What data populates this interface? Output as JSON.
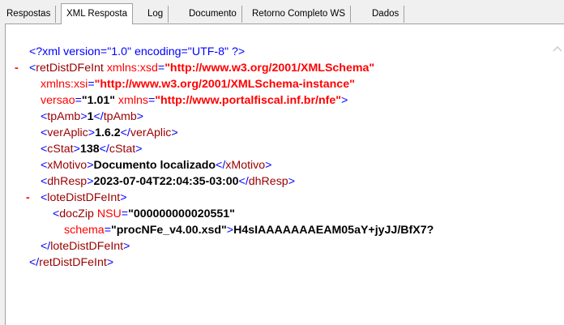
{
  "tabs": [
    {
      "label": "Respostas",
      "active": false
    },
    {
      "label": "XML Resposta",
      "active": true
    },
    {
      "label": "Log",
      "active": false
    },
    {
      "label": "Documento",
      "active": false
    },
    {
      "label": "Retorno Completo WS",
      "active": false
    },
    {
      "label": "Dados",
      "active": false
    }
  ],
  "xml": {
    "decl_open": "<?xml version=\"1.0\" encoding=\"UTF-8\" ?>",
    "toggle": "-",
    "root_open": "<",
    "root_name": "retDistDFeInt",
    "attr_xsd_name": " xmlns:xsd",
    "eq": "=",
    "attr_xsd_val": "\"http://www.w3.org/2001/XMLSchema\"",
    "attr_xsi_name": "xmlns:xsi",
    "attr_xsi_val": "\"http://www.w3.org/2001/XMLSchema-instance\"",
    "attr_versao_name": "versao",
    "attr_versao_val": "\"1.01\"",
    "attr_xmlns_name": " xmlns",
    "attr_xmlns_val": "\"http://www.portalfiscal.inf.br/nfe\"",
    "gt": ">",
    "lt": "<",
    "close_lt": "</",
    "tpAmb_name": "tpAmb",
    "tpAmb_val": "1",
    "verAplic_name": "verAplic",
    "verAplic_val": "1.6.2",
    "cStat_name": "cStat",
    "cStat_val": "138",
    "xMotivo_name": "xMotivo",
    "xMotivo_val": "Documento localizado",
    "dhResp_name": "dhResp",
    "dhResp_val": "2023-07-04T22:04:35-03:00",
    "lote_name": "loteDistDFeInt",
    "docZip_name": "docZip",
    "nsu_name": " NSU",
    "nsu_val": "\"000000000020551\"",
    "schema_name": "schema",
    "schema_val": "\"procNFe_v4.00.xsd\"",
    "docZip_content": "H4sIAAAAAAAEAM05aY+jyJJ/BfX7?"
  }
}
